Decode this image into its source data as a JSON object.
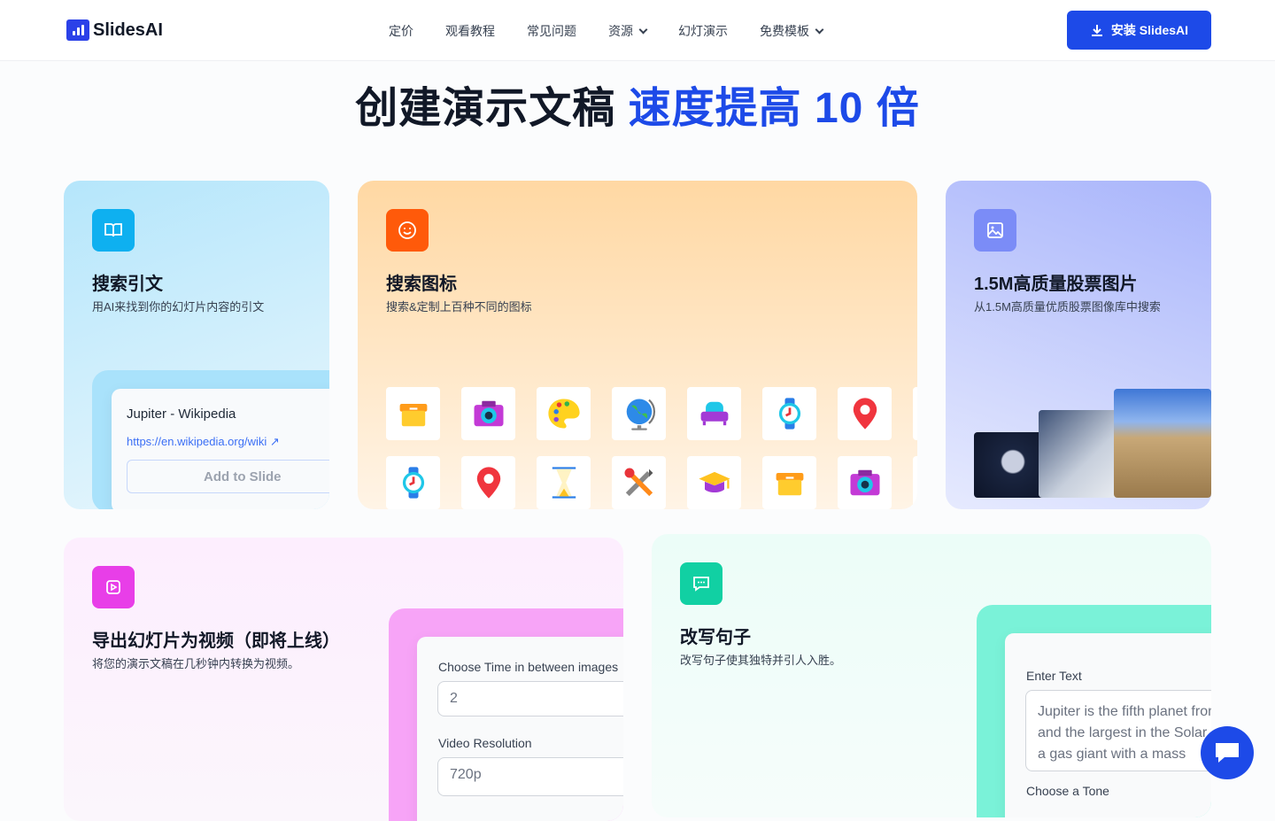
{
  "nav": {
    "brand": "SlidesAI",
    "items": [
      {
        "label": "定价"
      },
      {
        "label": "观看教程"
      },
      {
        "label": "常见问题"
      },
      {
        "label": "资源",
        "dropdown": true
      },
      {
        "label": "幻灯演示"
      },
      {
        "label": "免费模板",
        "dropdown": true
      }
    ],
    "install_label": "安装 SlidesAI"
  },
  "hero": {
    "title": "创建演示文稿",
    "accent": "速度提高 10 倍"
  },
  "cards": {
    "citation": {
      "title": "搜索引文",
      "desc": "用AI来找到你的幻灯片内容的引文",
      "result_title": "Jupiter - Wikipedia",
      "result_url": "https://en.wikipedia.org/wiki",
      "button": "Add to Slide"
    },
    "icons": {
      "title": "搜索图标",
      "desc": "搜索&定制上百种不同的图标",
      "row1": [
        "archive-box",
        "camera",
        "palette",
        "globe",
        "armchair",
        "watch",
        "map-pin"
      ],
      "row2": [
        "watch",
        "map-pin",
        "hourglass",
        "tools",
        "graduation-cap",
        "archive-box",
        "camera"
      ]
    },
    "images": {
      "title": "1.5M高质量股票图片",
      "desc": "从1.5M高质量优质股票图像库中搜索"
    },
    "video": {
      "title": "导出幻灯片为视频（即将上线）",
      "desc": "将您的演示文稿在几秒钟内转换为视频。",
      "time_label": "Choose Time in between images",
      "time_value": "2",
      "res_label": "Video Resolution",
      "res_value": "720p"
    },
    "rewrite": {
      "title": "改写句子",
      "desc": "改写句子使其独特并引人入胜。",
      "text_label": "Enter Text",
      "text_value": "Jupiter is the fifth planet from the Sun and the largest in the Solar System. It is a gas giant with a mass",
      "tone_label": "Choose a Tone"
    }
  },
  "colors": {
    "primary": "#1d4ae8"
  }
}
